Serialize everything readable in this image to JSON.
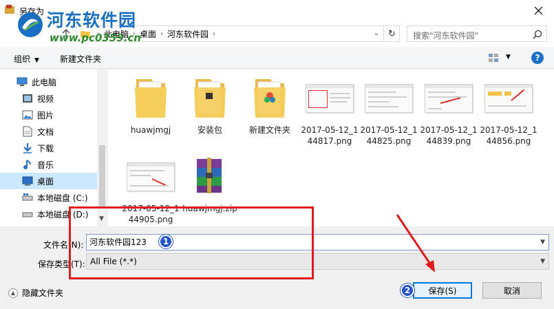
{
  "window": {
    "title": "另存为"
  },
  "watermark": {
    "brand": "河东软件园",
    "url": "www.pc0359.cn"
  },
  "address": {
    "crumbs": [
      "此电脑",
      "桌面",
      "河东软件园"
    ],
    "search_placeholder": "搜索\"河东软件园\""
  },
  "toolbar": {
    "organize_label": "组织",
    "new_folder_label": "新建文件夹",
    "help_label": "?"
  },
  "sidebar": {
    "items": [
      {
        "label": "此电脑",
        "icon": "pc-icon"
      },
      {
        "label": "视频",
        "icon": "video-icon"
      },
      {
        "label": "图片",
        "icon": "picture-icon"
      },
      {
        "label": "文档",
        "icon": "document-icon"
      },
      {
        "label": "下载",
        "icon": "download-icon"
      },
      {
        "label": "音乐",
        "icon": "music-icon"
      },
      {
        "label": "桌面",
        "icon": "desktop-icon",
        "selected": true
      },
      {
        "label": "本地磁盘 (C:)",
        "icon": "disk-icon"
      },
      {
        "label": "本地磁盘 (D:)",
        "icon": "disk-icon"
      }
    ]
  },
  "files": [
    {
      "name": "huawjmgj",
      "type": "folder"
    },
    {
      "name": "安装包",
      "type": "folder"
    },
    {
      "name": "新建文件夹",
      "type": "folder"
    },
    {
      "name": "2017-05-12_144817.png",
      "type": "image"
    },
    {
      "name": "2017-05-12_144825.png",
      "type": "image"
    },
    {
      "name": "2017-05-12_144839.png",
      "type": "image"
    },
    {
      "name": "2017-05-12_144856.png",
      "type": "image"
    },
    {
      "name": "2017-05-12_144905.png",
      "type": "image"
    },
    {
      "name": "huawjmgj.zip",
      "type": "archive"
    }
  ],
  "form": {
    "filename_label": "文件名(N):",
    "filename_value": "河东软件园123",
    "savetype_label": "保存类型(T):",
    "savetype_value": "All File (*.*)"
  },
  "footer": {
    "hide_folders_label": "隐藏文件夹",
    "save_label": "保存(S)",
    "cancel_label": "取消"
  },
  "annotations": {
    "badge1": "1",
    "badge2": "2"
  },
  "colors": {
    "accent": "#0078d7",
    "selection": "#cce8ff",
    "annotation_red": "#e11b1b",
    "badge_blue": "#2453c9"
  }
}
